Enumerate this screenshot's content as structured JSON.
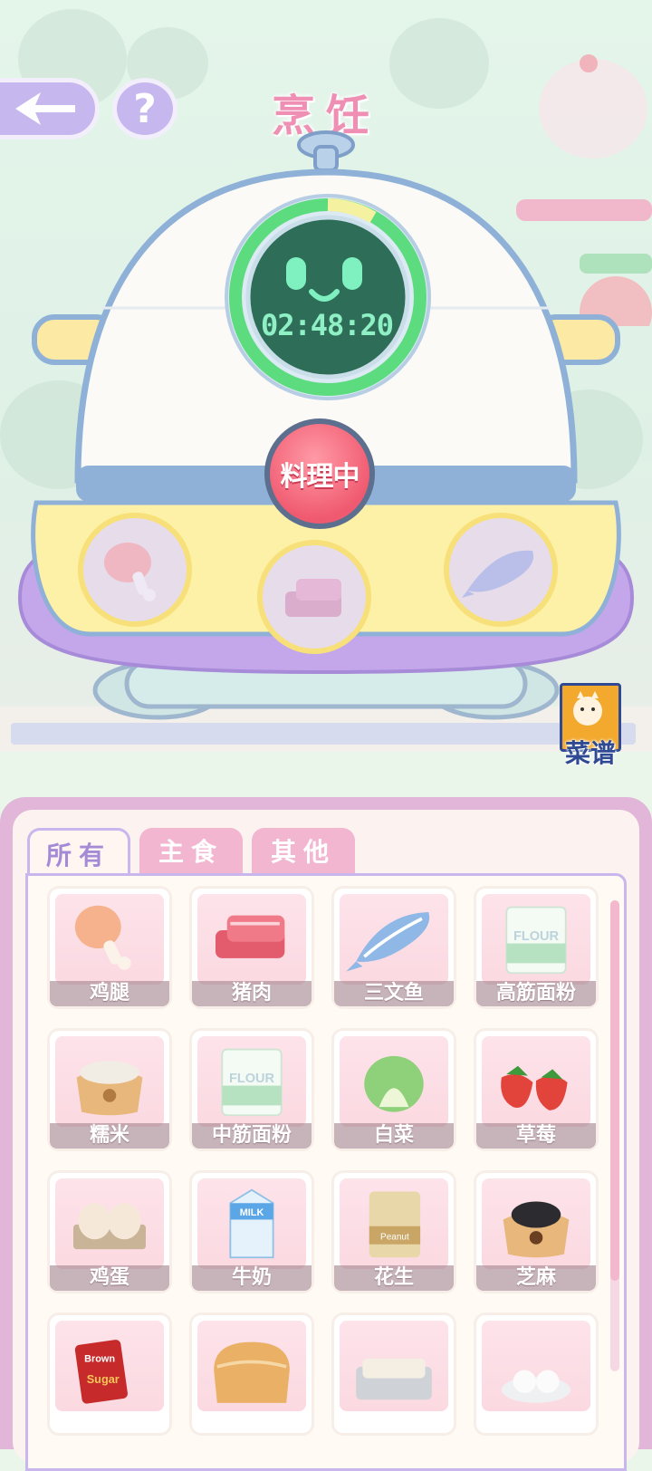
{
  "header": {
    "title": "烹饪",
    "help_label": "?"
  },
  "cooker": {
    "timer": "02:48:20",
    "cook_button_label": "料理中"
  },
  "recipe_button": {
    "label": "菜谱"
  },
  "slots": [
    {
      "icon": "drumstick-icon"
    },
    {
      "icon": "pork-icon"
    },
    {
      "icon": "salmon-icon"
    }
  ],
  "tabs": [
    {
      "label": "所有",
      "active": true
    },
    {
      "label": "主食",
      "active": false
    },
    {
      "label": "其他",
      "active": false
    }
  ],
  "ingredients": [
    {
      "label": "鸡腿",
      "icon": "drumstick-icon"
    },
    {
      "label": "猪肉",
      "icon": "pork-icon"
    },
    {
      "label": "三文鱼",
      "icon": "salmon-icon"
    },
    {
      "label": "高筋面粉",
      "icon": "flour-bag-icon"
    },
    {
      "label": "糯米",
      "icon": "rice-sack-icon"
    },
    {
      "label": "中筋面粉",
      "icon": "flour-bag-icon"
    },
    {
      "label": "白菜",
      "icon": "cabbage-icon"
    },
    {
      "label": "草莓",
      "icon": "strawberry-icon"
    },
    {
      "label": "鸡蛋",
      "icon": "eggs-icon"
    },
    {
      "label": "牛奶",
      "icon": "milk-carton-icon"
    },
    {
      "label": "花生",
      "icon": "peanut-bag-icon"
    },
    {
      "label": "芝麻",
      "icon": "sesame-sack-icon"
    },
    {
      "label": "",
      "icon": "brown-sugar-icon"
    },
    {
      "label": "",
      "icon": "bread-loaf-icon"
    },
    {
      "label": "",
      "icon": "butter-tray-icon"
    },
    {
      "label": "",
      "icon": "rice-balls-icon"
    }
  ],
  "icon_texts": {
    "flour": "FLOUR",
    "milk": "MILK",
    "peanut": "Peanut",
    "sugar_top": "Brown",
    "sugar_bottom": "Sugar"
  },
  "colors": {
    "title_pink": "#f08fb4",
    "accent_purple": "#c8b6ec",
    "cook_red": "#f05a70",
    "timer_green": "#5cdc7e"
  }
}
